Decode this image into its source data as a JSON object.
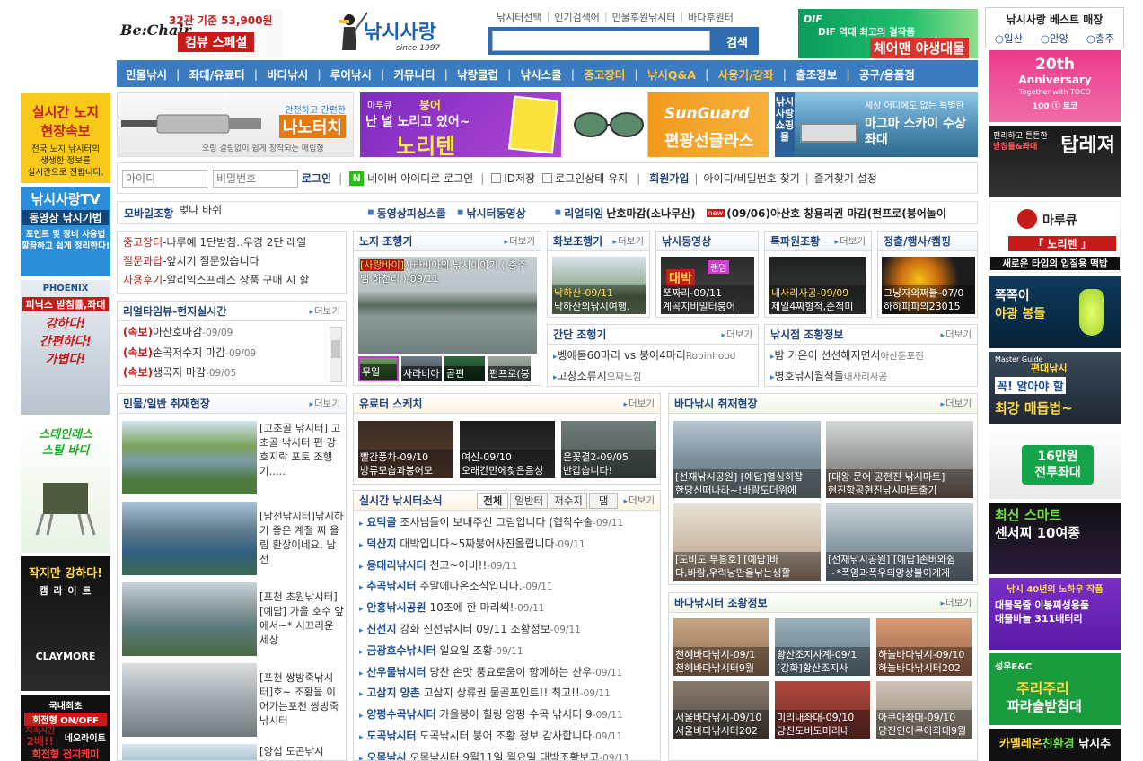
{
  "brand": {
    "name": "낚시사랑",
    "since": "since 1997",
    "logo_tag": "Be:Chair"
  },
  "header": {
    "promo_text": "32관 기준 53,900원",
    "promo_sub": "컴뷰 스페셜",
    "quick_links": [
      "낚시터선택",
      "인기검색어",
      "민물후원낚시터",
      "바다후원터"
    ],
    "search_button": "검색",
    "dif_ad_line1": "DIF 역대 최고의 걸작품",
    "dif_ad_line2": "체어맨 야생대물"
  },
  "nav": [
    "민물낚시",
    "좌대/유료터",
    "바다낚시",
    "루어낚시",
    "커뮤니티",
    "낚랑클럽",
    "낚시스쿨",
    "중고장터",
    "낚시Q&A",
    "사용기/강좌",
    "출조정보",
    "공구/용품점"
  ],
  "best_store": {
    "title": "낚시사랑 베스트 매장",
    "options": [
      "일산",
      "안양",
      "충주"
    ]
  },
  "banners": {
    "nanotouch_sub": "안전하고 간편한",
    "nanotouch": "나노터치",
    "nanotouch_desc": "오링 걸림없이 쉽게 장착되는 매립형",
    "noriten_brand": "마루큐",
    "noriten_line1": "붕어",
    "noriten_line2": "난 널 노리고 있어~",
    "noriten": "노리텐",
    "sunguard_brand": "SunGuard",
    "sunguard": "편광선글라스",
    "shop_label": "낚시사랑 쇼핑몰",
    "magma_line1": "세상 어디에도 없는 특별한",
    "magma": "마그마 스카이 수상좌대"
  },
  "login": {
    "id_placeholder": "아이디",
    "pw_placeholder": "비밀번호",
    "login_button": "로그인",
    "naver_login": "네이버 아이디로 로그인",
    "save_id": "ID저장",
    "keep_login": "로그인상태 유지",
    "join": "회원가입",
    "find": "아이디/비밀번호 찾기",
    "bookmark": "즐겨찾기 설정"
  },
  "ticker": {
    "mobile_label": "모바일조황",
    "mobile_text": "벚나 바쉬",
    "links": [
      "동영상피싱스쿨",
      "낚시터동영상"
    ],
    "realtime_label": "리얼타임",
    "realtime_text": "난호마감(소나무산)",
    "new_badge": "new",
    "news_text": "(09/06)아산호 창용리권 마감(펀프로(붕어놀이"
  },
  "notice": [
    {
      "cat": "중고장터",
      "text": "-나루예 1단받침..우경 2단 레일"
    },
    {
      "cat": "질문과답",
      "text": "-앞치기 질문있습니다"
    },
    {
      "cat": "사용후기",
      "text": "-알리익스프레스 상품 구매 시 할"
    }
  ],
  "realtime": {
    "title": "리얼타임뷰-현지실시간",
    "more": "더보기",
    "items": [
      {
        "tag": "(속보)",
        "text": "아산호마감",
        "date": "-09/09"
      },
      {
        "tag": "(속보)",
        "text": "손곡저수지 마감",
        "date": "-09/09"
      },
      {
        "tag": "(속보)",
        "text": "생곡지 마감",
        "date": "-09/05"
      }
    ]
  },
  "noji": {
    "title": "노지 조행기",
    "more": "더보기",
    "main_tag": "[사랑바이]",
    "main_text": "사라비아의 낚시이야기 ( 충주댐 하천리 )",
    "main_date": "-09/11",
    "thumbs": [
      "무일",
      "사라비아",
      "곧편",
      "펀프로(붕"
    ]
  },
  "photo": {
    "title": "화보조행기",
    "more": "더보기",
    "cap1": "낙하산-09/11",
    "cap2": "낙하산의낚시여행."
  },
  "video": {
    "title": "낚시동영상",
    "cap1": "쪼짜리-09/11",
    "cap2": "계곡지비밀터붕어"
  },
  "special": {
    "title": "특파원조황",
    "more": "더보기",
    "cap1": "내사리사공-09/09",
    "cap2": "제일4짜형척,준척미"
  },
  "event": {
    "title": "정출/행사/캠핑",
    "cap1": "그냥자와쩌블-07/0",
    "cap2": "하하파파의23015"
  },
  "simple": {
    "title": "간단 조행기",
    "more": "더보기",
    "items": [
      {
        "text": "벵에돔60마리 vs 붕어4마리",
        "author": "Robinhood"
      },
      {
        "text": "고창소류지",
        "author": "오짜느낌"
      }
    ]
  },
  "shopnews": {
    "title": "낚시점 조황정보",
    "more": "더보기",
    "items": [
      {
        "text": "밤 기온이 선선해지면서",
        "author": "아산둔포전"
      },
      {
        "text": "병호낚시월척들",
        "author": "내사리사공"
      }
    ]
  },
  "mulmul": {
    "title": "민물/일반 취재현장",
    "more": "더보기",
    "items": [
      "[고초골 낚시터] 고초골 낚시터 편 강호지락 포토 조행기.....",
      "[남전낚시터]낚시하기 좋은 계절 찌 올림 환상이네요. 남전",
      "[포천 초원낚시터][예답] 가을 호수 앞에서~* 시끄러운 세상",
      "[포천 쌍방죽낚시터]호~ 조황을 이어가는포천 쌍방죽낚시터",
      "[양섭 도곤낚시"
    ]
  },
  "sketch": {
    "title": "유료터 스케치",
    "more": "더보기",
    "items": [
      {
        "cap1": "빨간풍차-09/10",
        "cap2": "방류모습과붕어모"
      },
      {
        "cap1": "여신-09/10",
        "cap2": "오래간만에찾은음성"
      },
      {
        "cap1": "은꽃결2-09/05",
        "cap2": "반갑습니다!"
      }
    ]
  },
  "live": {
    "title": "실시간 낚시터소식",
    "tabs": [
      "전체",
      "일반터",
      "저수지",
      "댐"
    ],
    "more": "더보기",
    "items": [
      {
        "name": "요덕골",
        "text": "조사님들이 보내주신 그림입니다 (협착수술",
        "date": "-09/11"
      },
      {
        "name": "덕산지",
        "text": "대박입니다~5짜붕어사진올립니다",
        "date": "-09/11"
      },
      {
        "name": "용대리낚시터",
        "text": "천고~어비!!",
        "date": "-09/11"
      },
      {
        "name": "추곡낚시터",
        "text": "주말에나온소식입니다.",
        "date": "-09/11"
      },
      {
        "name": "안흥낚시공원",
        "text": "10조에 한 마리씩!",
        "date": "-09/11"
      },
      {
        "name": "신선지",
        "text": "강화 신선낚시터 09/11 조황정보",
        "date": "-09/11"
      },
      {
        "name": "금광호수낚시터",
        "text": "일요일 조황",
        "date": "-09/11"
      },
      {
        "name": "산우물낚시터",
        "text": "당찬 손맛 풍요로움이 함께하는 산우",
        "date": "-09/11"
      },
      {
        "name": "고삼지 양촌",
        "text": "고삼지 상류권 물골포인트!! 최고!!",
        "date": "-09/11"
      },
      {
        "name": "양평수곡낚시터",
        "text": "가을붕어 힐링 양평 수곡 낚시터 9",
        "date": "-09/11"
      },
      {
        "name": "도곡낚시터",
        "text": "도곡낚시터 붕어 조황 정보 감사합니다",
        "date": "-09/11"
      },
      {
        "name": "오목낚시",
        "text": "오목낚시터 9월11일 월요일 대박조황보고",
        "date": "-09/11"
      }
    ]
  },
  "sea": {
    "title": "바다낚시 취재현장",
    "more": "더보기",
    "items": [
      {
        "cap1": "[선재낚시공원] [예답]열심히잡",
        "cap2": "한당신떠나라~!바람도더위에"
      },
      {
        "cap1": "[대왕 문어 공현진 낚시마트]",
        "cap2": "현진항공현진낚시마트출기"
      },
      {
        "cap1": "[도비도 부흥호] [예답]바",
        "cap2": "다,바람,우럭낭만을낚는생활"
      },
      {
        "cap1": "[선재낚시공원] [예답]존버와쉼",
        "cap2": "~*폭염과폭우의앙상블이계게"
      }
    ]
  },
  "seainfo": {
    "title": "바다낚시터 조황정보",
    "more": "더보기",
    "items": [
      {
        "cap1": "천혜바다낚시-09/1",
        "cap2": "천혜바다낚시터9월"
      },
      {
        "cap1": "황산조지사계-09/1",
        "cap2": "[강화]황산조지사"
      },
      {
        "cap1": "하늘바다낚시-09/10",
        "cap2": "하늘바다낚시터202"
      },
      {
        "cap1": "서울바다낚시-09/10",
        "cap2": "서울바다낚시터202"
      },
      {
        "cap1": "미리내좌대-09/10",
        "cap2": "당진도비도미리내"
      },
      {
        "cap1": "아쿠아좌대-09/10",
        "cap2": "당진인아쿠아좌대9월"
      }
    ]
  },
  "left_ads": [
    {
      "l1": "실시간 노지",
      "l2": "현장속보",
      "l3": "전국 노지 낚시터의",
      "l4": "생생한 정보를",
      "l5": "실시간으로 전합니다."
    },
    {
      "l1": "낚시사랑TV",
      "l2": "동영상 낚시기법",
      "l3": "포인트 및 장비 사용법",
      "l4": "깔끔하고 쉽게 정리한다!"
    },
    {
      "l1": "PHOENIX",
      "l2": "피닉스 받침틀,좌대",
      "l3": "강하다!",
      "l4": "간편하다!",
      "l5": "가볍다!"
    },
    {
      "l1": "스테인레스",
      "l2": "스틸 바디"
    },
    {
      "l1": "작지만 강하다!",
      "l2": "캠 라 이 트",
      "l3": "CLAYMORE"
    },
    {
      "l1": "국내최초",
      "l2": "회전형 ON/OFF",
      "l3": "지속시간",
      "l4": "2배!!",
      "l5": "네오라이트",
      "l6": "회전형 전지케미"
    }
  ],
  "right_ads": [
    {
      "l1": "20th",
      "l2": "Anniversary",
      "l3": "Together with TOCO"
    },
    {
      "l1": "편리하고 튼튼한",
      "l2": "받침틀&좌대",
      "l3": "탑레져"
    },
    {
      "l1": "마루큐",
      "l2": "「 노리텐 」",
      "l3": "새로운 타입의 입질용 떡밥"
    },
    {
      "l1": "쪽쪽이",
      "l2": "야광 봉돌"
    },
    {
      "l1": "Master Guide",
      "l2": "편대낚시",
      "l3": "꼭! 알아야 할",
      "l4": "최강 매듭법~"
    },
    {
      "l1": "16만원",
      "l2": "전투좌대"
    },
    {
      "l1": "최신 스마트",
      "l2": "센서찌 10여종"
    },
    {
      "l1": "낚시 40년의 노하우 작품",
      "l2": "대물목줄 이봉찌성용품",
      "l3": "대물바늘 311배터리"
    },
    {
      "l1": "성우E&C",
      "l2": "주리주리",
      "l3": "파라솔받침대"
    },
    {
      "l1": "카멜레온",
      "l2": "친환경",
      "l3": "낚시추"
    }
  ],
  "colors": {
    "nav_bg": "#3b7bbf",
    "accent_orange": "#f4a020",
    "header_blue": "#23447a",
    "red": "#c41b1b"
  }
}
